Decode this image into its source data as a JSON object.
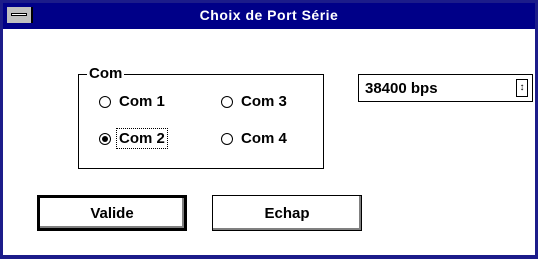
{
  "window": {
    "title": "Choix de Port Série"
  },
  "group": {
    "label": "Com",
    "options": [
      {
        "label": "Com 1",
        "checked": false
      },
      {
        "label": "Com 2",
        "checked": true
      },
      {
        "label": "Com 3",
        "checked": false
      },
      {
        "label": "Com 4",
        "checked": false
      }
    ]
  },
  "speed": {
    "value": "38400 bps",
    "icon": "dropdown-arrow-icon"
  },
  "buttons": {
    "valide": "Valide",
    "echap": "Echap"
  },
  "colors": {
    "titlebar": "#000088",
    "frame": "#1c1c8a"
  }
}
